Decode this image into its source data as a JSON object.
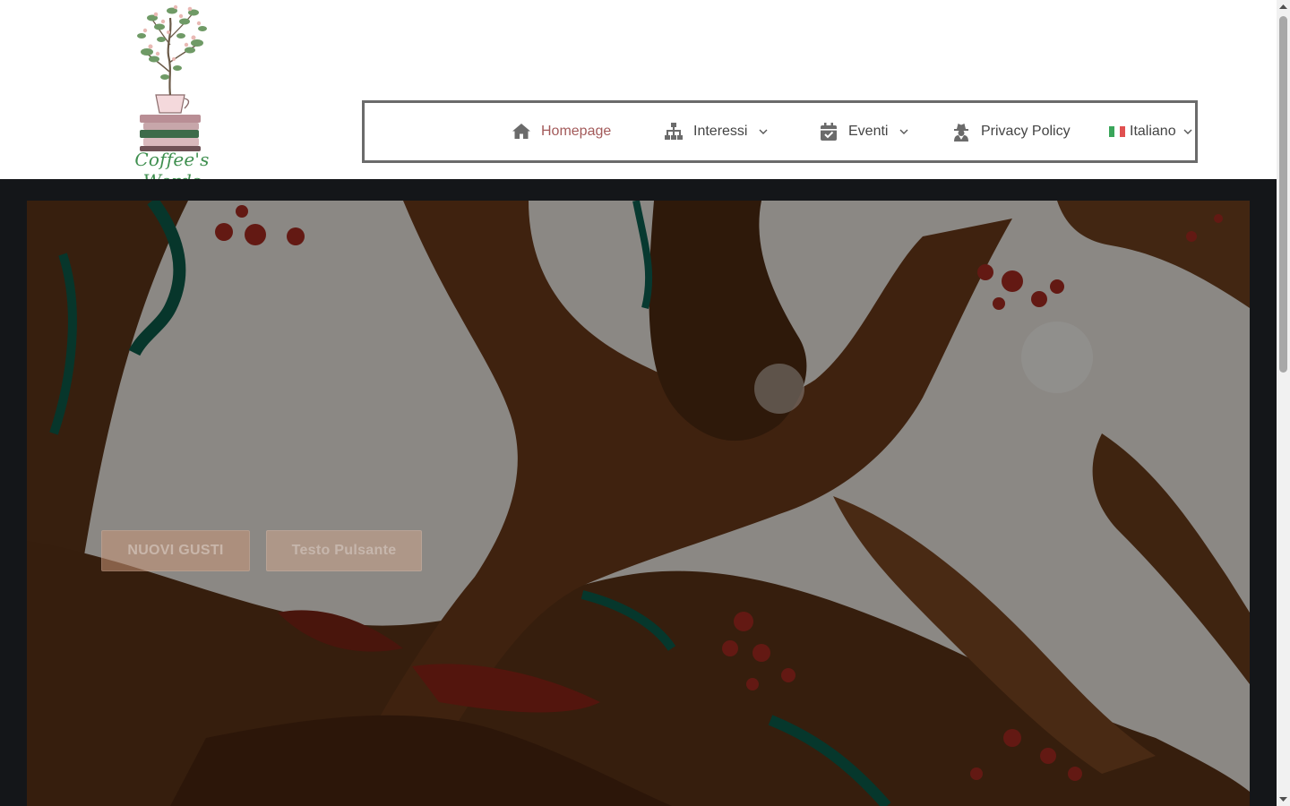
{
  "logo": {
    "text": "Coffee's Words"
  },
  "nav": {
    "items": [
      {
        "label": "Homepage",
        "icon": "home-icon",
        "active": true
      },
      {
        "label": "Interessi",
        "icon": "sitemap-icon",
        "dropdown": true
      },
      {
        "label": "Eventi",
        "icon": "calendar-check-icon",
        "dropdown": true
      },
      {
        "label": "Privacy Policy",
        "icon": "user-secret-icon"
      },
      {
        "label": "Italiano",
        "icon": "italy-flag-icon",
        "dropdown": true
      }
    ]
  },
  "hero": {
    "primary_button": "NUOVI GUSTI",
    "secondary_button": "Testo Pulsante"
  },
  "colors": {
    "accent": "#a35a5a",
    "nav_icon": "#6b6b6b",
    "hero_frame": "#141619",
    "logo_green": "#3f8f4f"
  }
}
